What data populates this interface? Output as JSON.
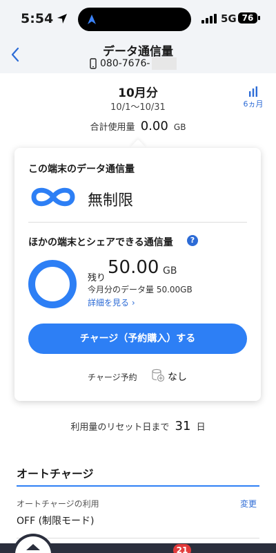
{
  "status_bar": {
    "time": "5:54",
    "network": "5G",
    "battery": "76"
  },
  "header": {
    "title": "データ通信量",
    "phone_number": "080-7676-"
  },
  "summary": {
    "month": "10月分",
    "date_range": "10/1〜10/31",
    "history_button": "6ヵ月",
    "total_label": "合計使用量",
    "total_value": "0.00",
    "total_unit": "GB"
  },
  "card": {
    "device_section_title": "この端末のデータ通信量",
    "unlimited_label": "無制限",
    "share_section_title": "ほかの端末とシェアできる通信量",
    "remaining_label": "残り",
    "remaining_value": "50.00",
    "remaining_unit": "GB",
    "month_data_text": "今月分のデータ量 50.00GB",
    "detail_link": "詳細を見る ›",
    "charge_button": "チャージ（予約購入）する",
    "reservation_label": "チャージ予約",
    "reservation_value": "なし"
  },
  "reset": {
    "prefix": "利用量のリセット日まで",
    "days": "31",
    "suffix": "日"
  },
  "auto_charge": {
    "title": "オートチャージ",
    "usage_label": "オートチャージの利用",
    "change_link": "変更",
    "status": "OFF (制限モード)"
  },
  "tab_bar": {
    "badge_count": "21"
  },
  "colors": {
    "accent": "#2d7ff5",
    "link": "#2c6bd6",
    "tab_bar": "#2b2f3d",
    "badge": "#e23b3b"
  }
}
